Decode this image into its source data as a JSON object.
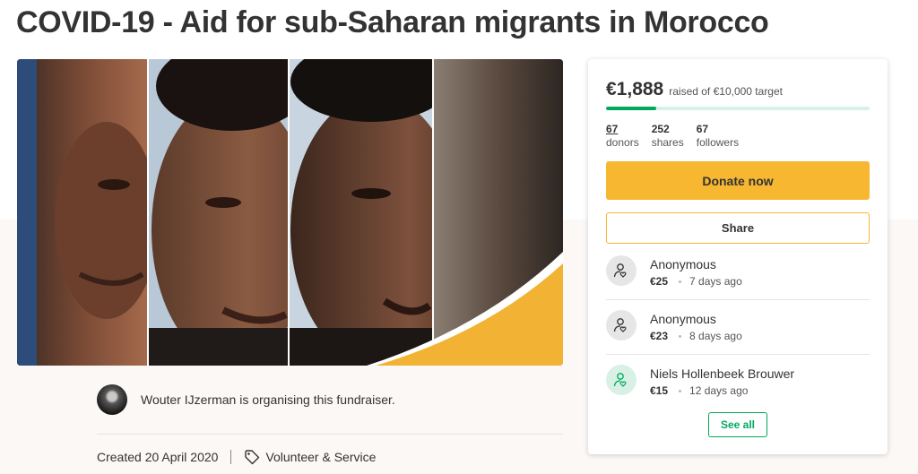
{
  "page": {
    "title": "COVID-19 - Aid for sub-Saharan migrants in Morocco"
  },
  "hero": {
    "icon": "portrait-collage-image",
    "accent_color": "#f2b233"
  },
  "organiser": {
    "text": "Wouter IJzerman is organising this fundraiser."
  },
  "meta": {
    "created": "Created 20 April 2020",
    "category": "Volunteer & Service"
  },
  "card": {
    "raised_amount": "€1,888",
    "target_text": "raised of €10,000 target",
    "progress_fraction": 0.1888,
    "stats": [
      {
        "value": "67",
        "label": "donors"
      },
      {
        "value": "252",
        "label": "shares"
      },
      {
        "value": "67",
        "label": "followers"
      }
    ],
    "donate_label": "Donate now",
    "share_label": "Share",
    "donations": [
      {
        "name": "Anonymous",
        "amount": "€25",
        "time": "7 days ago",
        "icon": "donor-heart-icon"
      },
      {
        "name": "Anonymous",
        "amount": "€23",
        "time": "8 days ago",
        "icon": "donor-heart-icon"
      },
      {
        "name": "Niels Hollenbeek Brouwer",
        "amount": "€15",
        "time": "12 days ago",
        "icon": "donor-heart-icon"
      }
    ],
    "see_all_label": "See all"
  },
  "colors": {
    "brand_green": "#02a95c",
    "donate_yellow": "#f7b731"
  }
}
